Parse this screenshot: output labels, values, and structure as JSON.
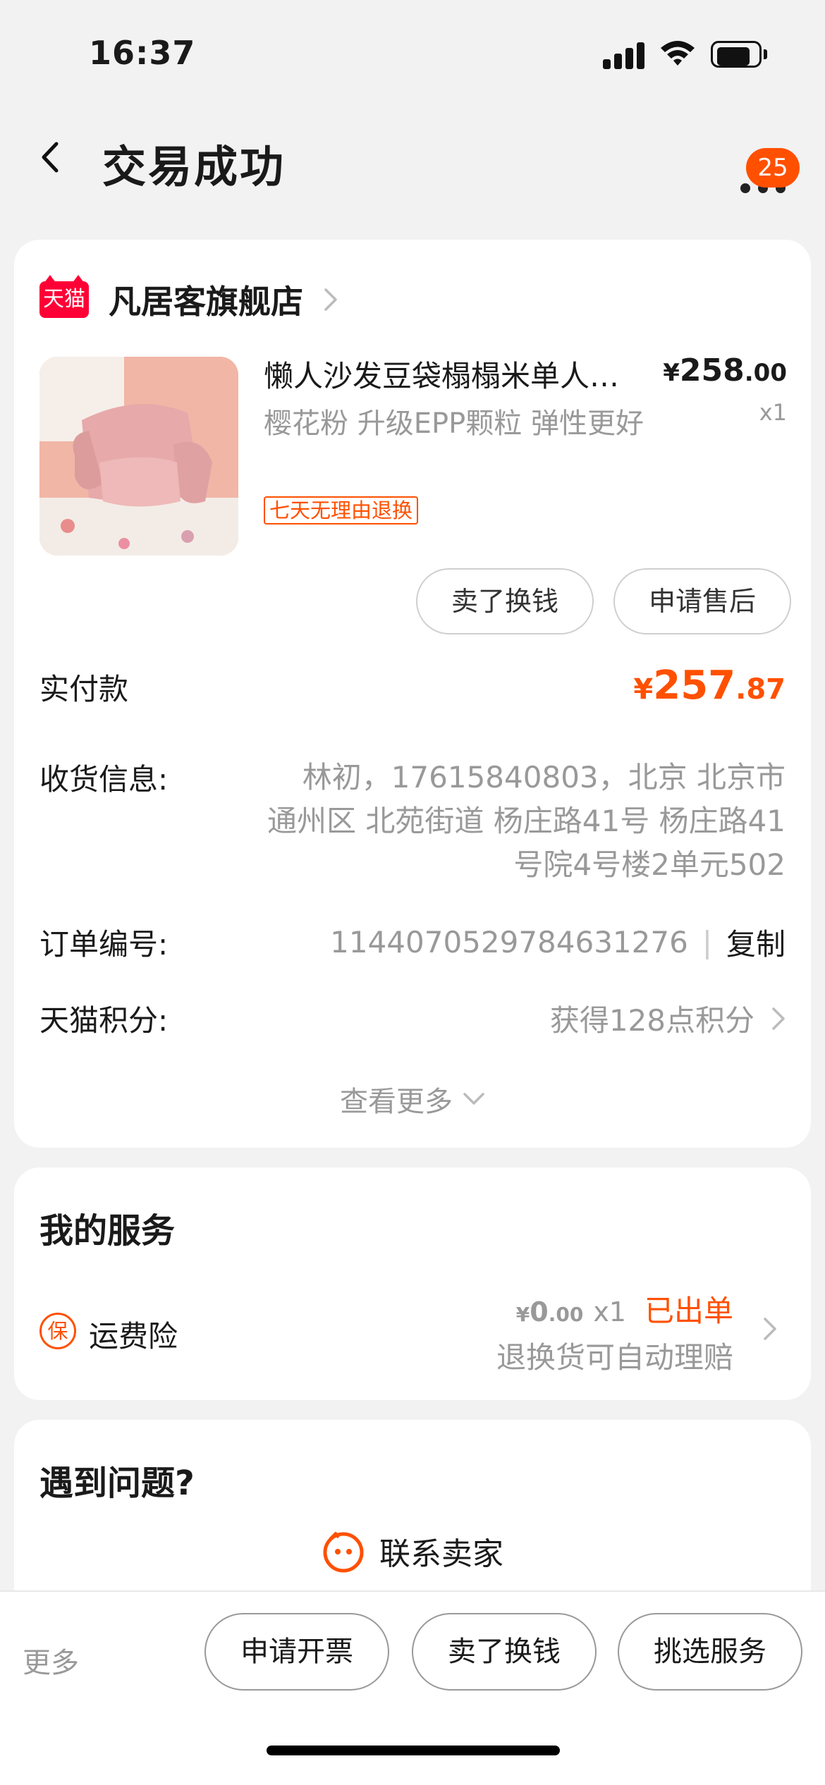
{
  "status_bar": {
    "time": "16:37"
  },
  "nav": {
    "title": "交易成功",
    "badge_count": "25"
  },
  "order": {
    "shop_logo_text": "天猫",
    "shop_name": "凡居客旗舰店",
    "product": {
      "title": "懒人沙发豆袋榻榻米单人…",
      "spec": "樱花粉  升级EPP颗粒 弹性更好",
      "return_tag": "七天无理由退换",
      "price_currency": "¥",
      "price_int": "258",
      "price_dec": ".00",
      "qty": "x1"
    },
    "buttons": {
      "sell": "卖了换钱",
      "after_sale": "申请售后"
    },
    "paid": {
      "label": "实付款",
      "currency": "¥",
      "int": "257",
      "dec": ".87"
    },
    "shipping": {
      "label": "收货信息:",
      "value": "林初，17615840803，北京 北京市 通州区 北苑街道 杨庄路41号 杨庄路41号院4号楼2单元502"
    },
    "order_no": {
      "label": "订单编号:",
      "value": "1144070529784631276",
      "separator": "|",
      "copy": "复制"
    },
    "points": {
      "label": "天猫积分:",
      "value": "获得128点积分"
    },
    "see_more": "查看更多"
  },
  "services": {
    "title": "我的服务",
    "insurance": {
      "icon_text": "保",
      "label": "运费险",
      "price_currency": "¥",
      "price_int": "0",
      "price_dec": ".00",
      "qty": "x1",
      "status": "已出单",
      "desc": "退换货可自动理赔"
    }
  },
  "help": {
    "title": "遇到问题?",
    "contact": "联系卖家"
  },
  "bottom_bar": {
    "more": "更多",
    "invoice": "申请开票",
    "sell": "卖了换钱",
    "pick_service": "挑选服务"
  },
  "colors": {
    "accent": "#ff5000",
    "tmall": "#ff0036"
  }
}
